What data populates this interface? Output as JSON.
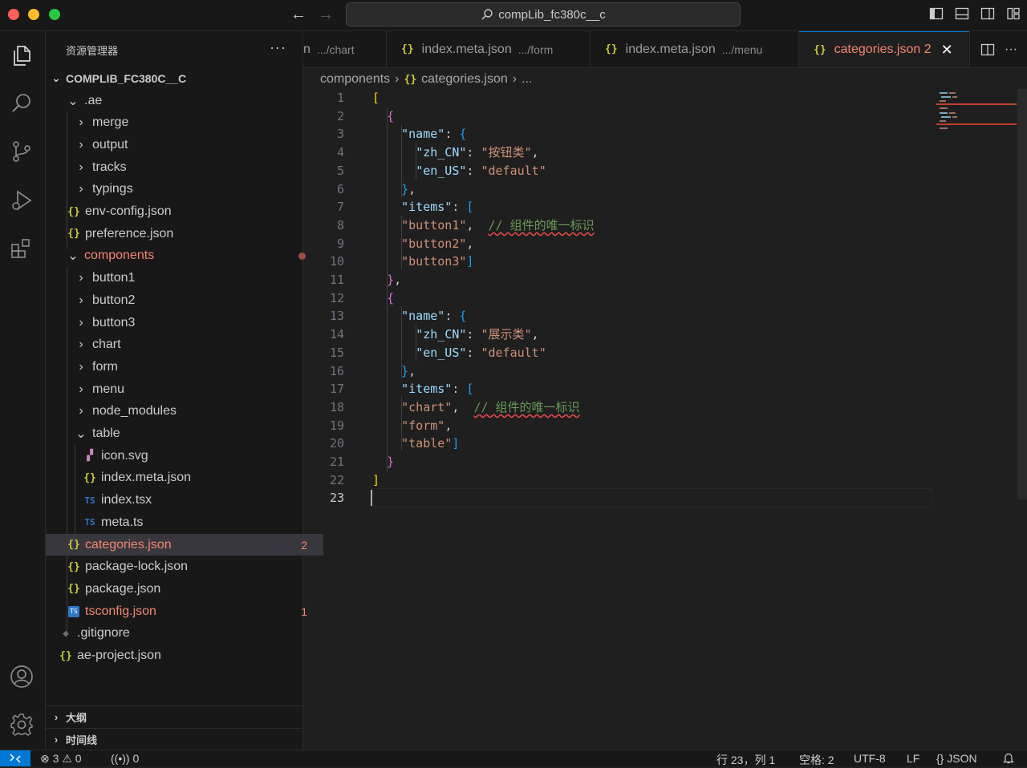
{
  "titlebar": {
    "search_text": "compLib_fc380c__c"
  },
  "sidebar": {
    "title": "资源管理器",
    "more": "···",
    "root": "COMPLIB_FC380C__C",
    "tree": [
      {
        "label": ".ae",
        "type": "folder-open"
      },
      {
        "label": "merge",
        "type": "folder"
      },
      {
        "label": "output",
        "type": "folder"
      },
      {
        "label": "tracks",
        "type": "folder"
      },
      {
        "label": "typings",
        "type": "folder"
      },
      {
        "label": "env-config.json",
        "type": "json"
      },
      {
        "label": "preference.json",
        "type": "json"
      },
      {
        "label": "components",
        "type": "folder-open"
      },
      {
        "label": "button1",
        "type": "folder"
      },
      {
        "label": "button2",
        "type": "folder"
      },
      {
        "label": "button3",
        "type": "folder"
      },
      {
        "label": "chart",
        "type": "folder"
      },
      {
        "label": "form",
        "type": "folder"
      },
      {
        "label": "menu",
        "type": "folder"
      },
      {
        "label": "node_modules",
        "type": "folder"
      },
      {
        "label": "table",
        "type": "folder-open"
      },
      {
        "label": "icon.svg",
        "type": "svg"
      },
      {
        "label": "index.meta.json",
        "type": "json"
      },
      {
        "label": "index.tsx",
        "type": "ts",
        "icon_text": "TS"
      },
      {
        "label": "meta.ts",
        "type": "ts",
        "icon_text": "TS"
      },
      {
        "label": "categories.json",
        "type": "json",
        "badge": "2"
      },
      {
        "label": "package-lock.json",
        "type": "json"
      },
      {
        "label": "package.json",
        "type": "json"
      },
      {
        "label": "tsconfig.json",
        "type": "tsjson",
        "badge": "1"
      },
      {
        "label": ".gitignore",
        "type": "git"
      },
      {
        "label": "ae-project.json",
        "type": "json"
      }
    ],
    "sections": [
      "大纲",
      "时间线"
    ]
  },
  "tabs": [
    {
      "label": "n",
      "desc": ".../chart"
    },
    {
      "label": "index.meta.json",
      "desc": ".../form"
    },
    {
      "label": "index.meta.json",
      "desc": ".../menu"
    },
    {
      "label": "categories.json 2",
      "desc": ""
    }
  ],
  "breadcrumb": [
    "components",
    "categories.json",
    "..."
  ],
  "code_lines": [
    "[",
    "  {",
    "    \"name\": {",
    "      \"zh_CN\": \"按钮类\",",
    "      \"en_US\": \"default\"",
    "    },",
    "    \"items\": [",
    "    \"button1\",  // 组件的唯一标识",
    "    \"button2\",",
    "    \"button3\"]",
    "  },",
    "  {",
    "    \"name\": {",
    "      \"zh_CN\": \"展示类\",",
    "      \"en_US\": \"default\"",
    "    },",
    "    \"items\": [",
    "    \"chart\",  // 组件的唯一标识",
    "    \"form\",",
    "    \"table\"]",
    "  }",
    "]",
    ""
  ],
  "status": {
    "errors": "3",
    "warnings": "0",
    "ports": "0",
    "position": "行 23，列 1",
    "spaces": "空格: 2",
    "encoding": "UTF-8",
    "eol": "LF",
    "language": "JSON"
  },
  "colors": {
    "accent": "#0078d4",
    "error": "#f48771",
    "json_icon": "#cbcb41"
  }
}
